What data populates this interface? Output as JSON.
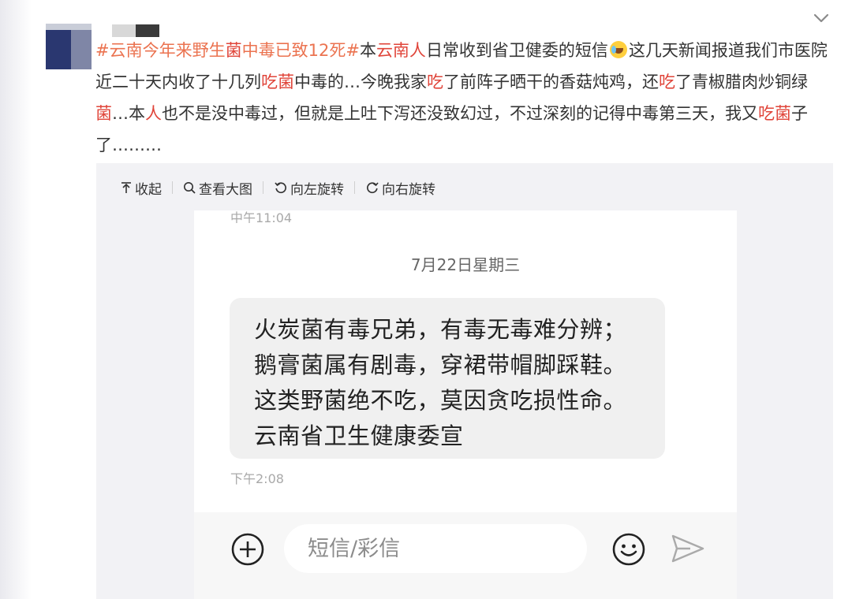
{
  "post": {
    "segments": [
      {
        "text": "#云南",
        "style": "tag"
      },
      {
        "text": "今年来野生",
        "style": "tag"
      },
      {
        "text": "菌",
        "style": "hl"
      },
      {
        "text": "中毒已致12死#",
        "style": "tag"
      },
      {
        "text": "本",
        "style": "normal"
      },
      {
        "text": "云南人",
        "style": "hl"
      },
      {
        "text": "日常收到省卫健委的短信",
        "style": "normal"
      },
      {
        "text": "",
        "style": "emoji"
      },
      {
        "text": "这几天新闻报道我们市医院近二十天内收了十几列",
        "style": "normal"
      },
      {
        "text": "吃菌",
        "style": "hl"
      },
      {
        "text": "中毒的…今晚我家",
        "style": "normal"
      },
      {
        "text": "吃",
        "style": "hl"
      },
      {
        "text": "了前阵子晒干的香菇炖鸡，还",
        "style": "normal"
      },
      {
        "text": "吃",
        "style": "hl"
      },
      {
        "text": "了青椒腊肉炒铜绿",
        "style": "normal"
      },
      {
        "text": "菌",
        "style": "hl"
      },
      {
        "text": "…本",
        "style": "normal"
      },
      {
        "text": "人",
        "style": "hl"
      },
      {
        "text": "也不是没中毒过，但就是上吐下泻还没致幻过，不过深刻的记得中毒第三天，我又",
        "style": "normal"
      },
      {
        "text": "吃菌",
        "style": "hl"
      },
      {
        "text": "子了………",
        "style": "normal"
      }
    ],
    "emoji_icon": "crying-laughing-emoji"
  },
  "toolbar": {
    "collapse_label": "收起",
    "view_large_label": "查看大图",
    "rotate_left_label": "向左旋转",
    "rotate_right_label": "向右旋转"
  },
  "sms": {
    "time_top": "中午11:04",
    "date": "7月22日星期三",
    "message_lines": [
      "火炭菌有毒兄弟，有毒无毒难分辨；",
      "鹅膏菌属有剧毒，穿裙带帽脚踩鞋。",
      "这类野菌绝不吃，莫因贪吃损性命。",
      "云南省卫生健康委宣"
    ],
    "time_bottom": "下午2:08",
    "input_placeholder": "短信/彩信"
  },
  "colors": {
    "topic": "#eb7350",
    "highlight": "#e0453a",
    "panel_bg": "#f2f2f5",
    "bubble_bg": "#f0f0f0"
  }
}
